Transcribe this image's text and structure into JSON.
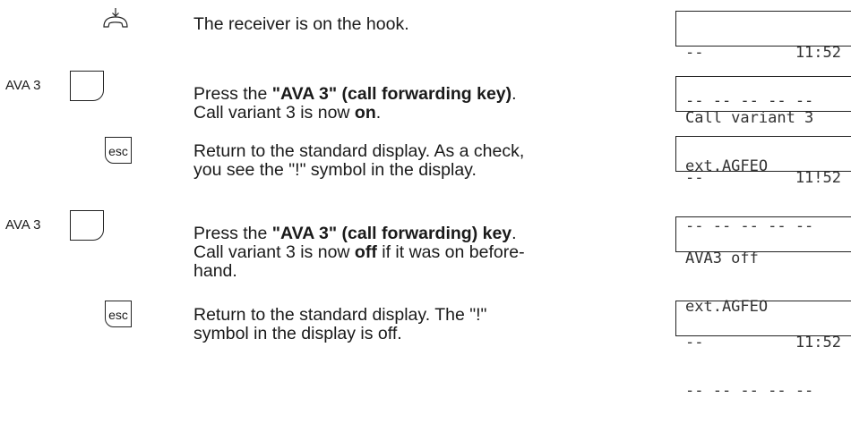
{
  "steps": [
    {
      "text": "The receiver is on the hook.",
      "display": [
        "--          11:52",
        "-- -- -- -- --"
      ]
    },
    {
      "key_label": "AVA 3",
      "text_parts": [
        "Press the ",
        "\"AVA 3\" (call forwarding key)",
        ".",
        "Call variant 3 is now ",
        "on",
        "."
      ],
      "display": [
        "Call variant 3",
        "ext.AGFEO"
      ]
    },
    {
      "key_text": "esc",
      "text_lines": [
        "Return to the standard display. As a check,",
        "you see the \"!\" symbol in the display."
      ],
      "display": [
        "--          11!52",
        "-- -- -- -- --"
      ]
    },
    {
      "key_label": "AVA 3",
      "text_parts": [
        "Press the ",
        "\"AVA 3\" (call forwarding) key",
        ".",
        "Call variant 3 is now ",
        "off",
        " if it was on before-",
        "hand."
      ],
      "display": [
        "AVA3 off",
        "ext.AGFEO"
      ]
    },
    {
      "key_text": "esc",
      "text_lines": [
        "Return to the standard display. The \"!\"",
        "symbol in the display is off."
      ],
      "display": [
        "--          11:52",
        "-- -- -- -- --"
      ]
    }
  ]
}
